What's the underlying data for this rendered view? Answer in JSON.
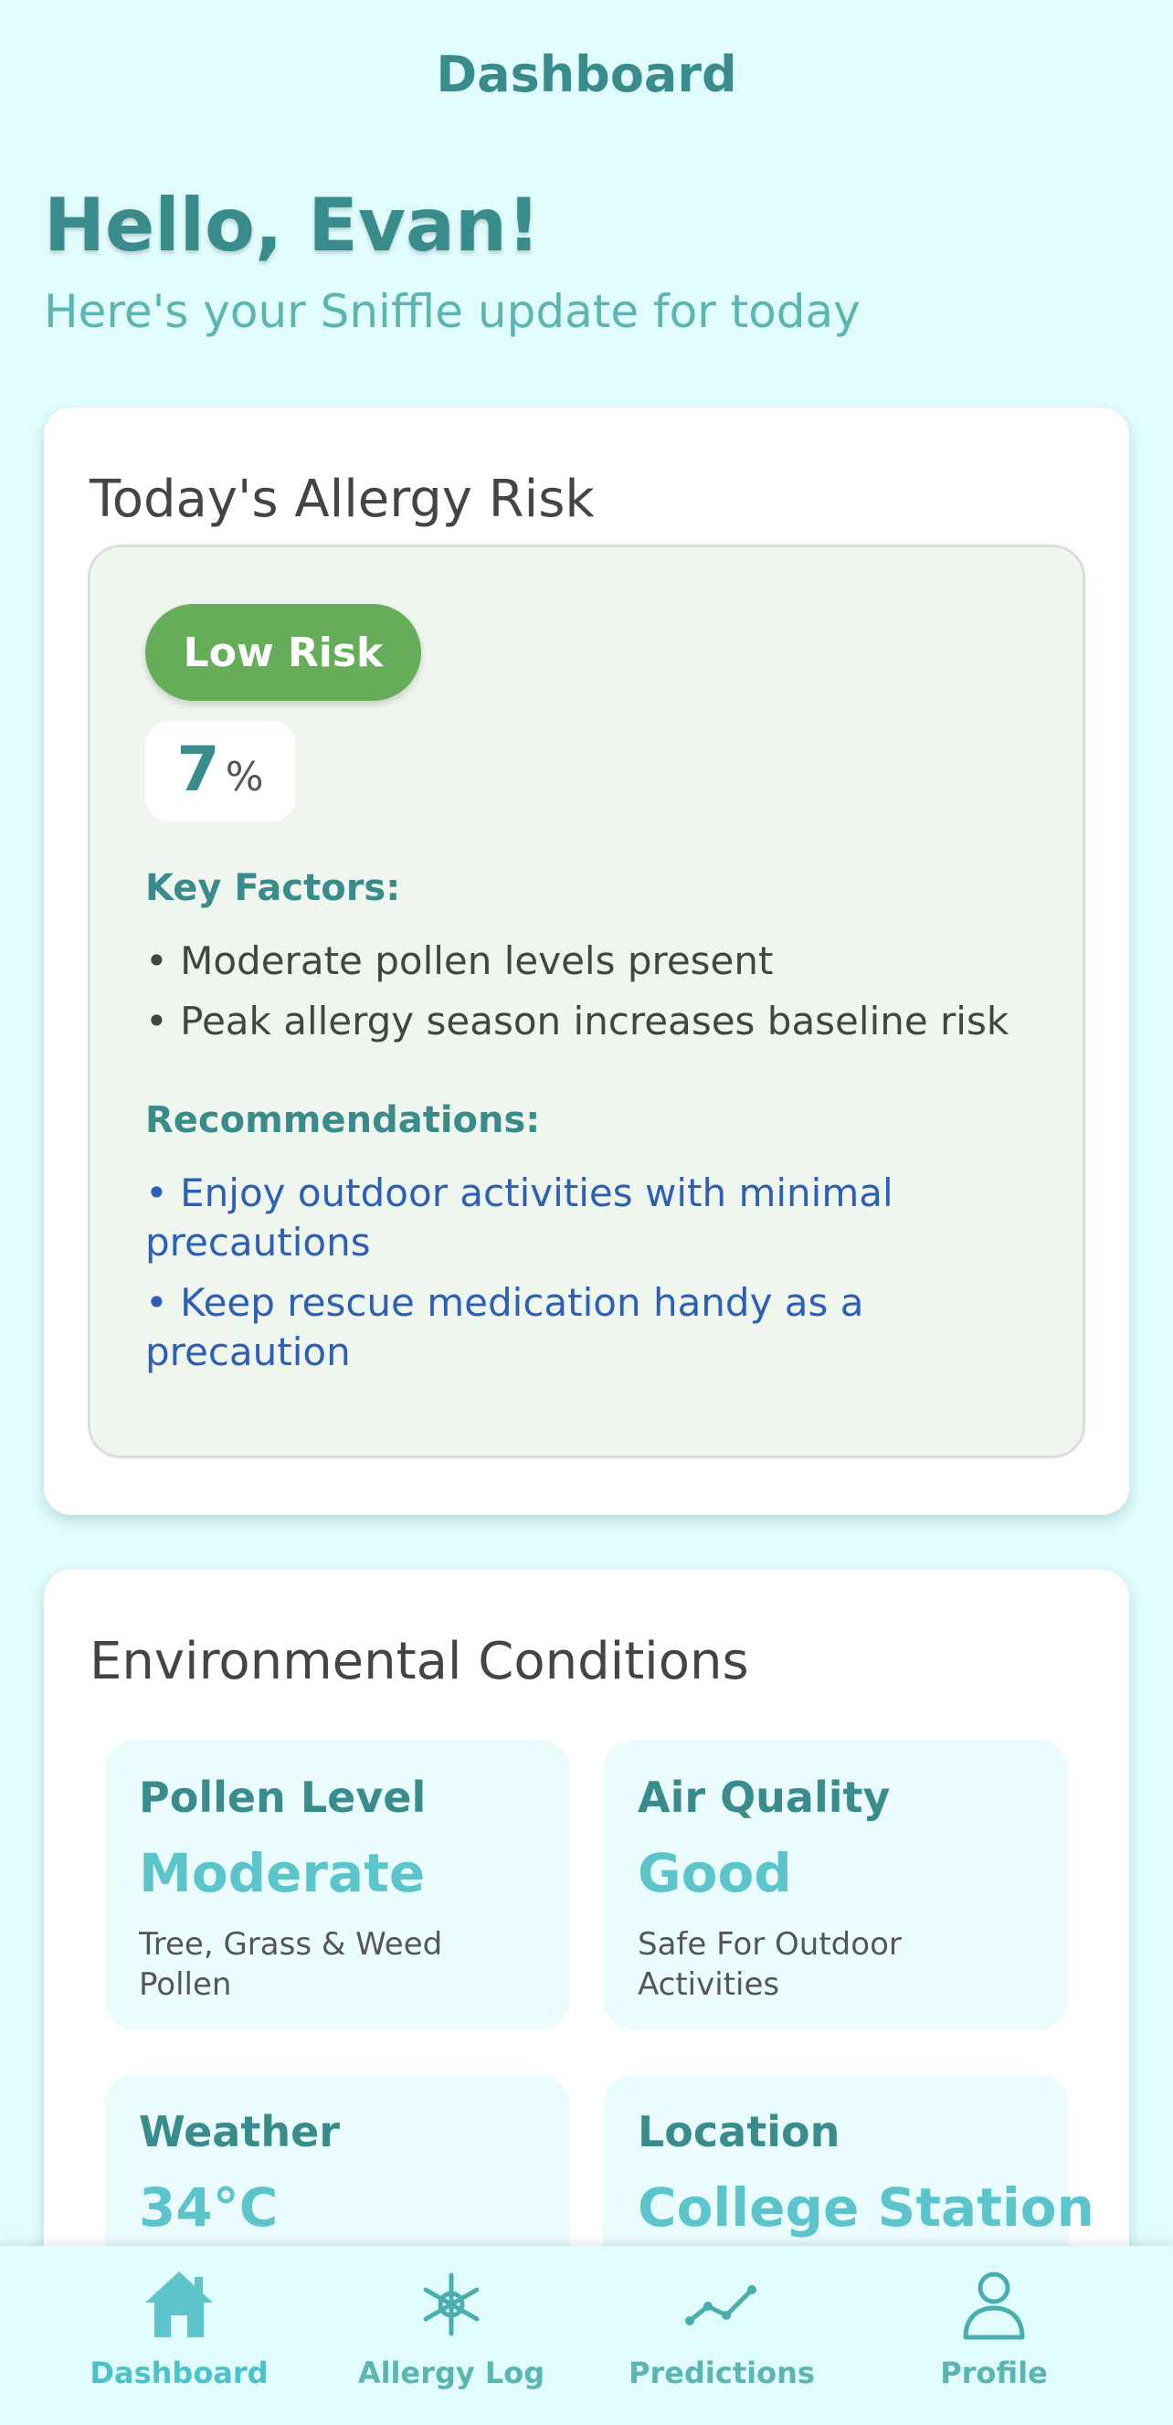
{
  "header": {
    "title": "Dashboard"
  },
  "greeting": {
    "title": "Hello, Evan!",
    "subtitle": "Here's your Sniffle update for today"
  },
  "risk_card": {
    "title": "Today's Allergy Risk",
    "badge": "Low Risk",
    "percent_value": "7",
    "percent_unit": "%",
    "factors_label": "Key Factors:",
    "factors": [
      "• Moderate pollen levels present",
      "• Peak allergy season increases baseline risk"
    ],
    "recommendations_label": "Recommendations:",
    "recommendations": [
      "• Enjoy outdoor activities with minimal precautions",
      "• Keep rescue medication handy as a precaution"
    ]
  },
  "env_card": {
    "title": "Environmental Conditions",
    "tiles": [
      {
        "label": "Pollen Level",
        "value": "Moderate",
        "desc": "Tree, Grass & Weed Pollen"
      },
      {
        "label": "Air Quality",
        "value": "Good",
        "desc": "Safe For Outdoor Activities"
      },
      {
        "label": "Weather",
        "value": "34°C",
        "desc": ""
      },
      {
        "label": "Location",
        "value": "College Station",
        "desc": ""
      }
    ]
  },
  "bottom_nav": {
    "items": [
      {
        "label": "Dashboard",
        "icon": "home-icon",
        "active": true
      },
      {
        "label": "Allergy Log",
        "icon": "asterisk-icon",
        "active": false
      },
      {
        "label": "Predictions",
        "icon": "trend-line-icon",
        "active": false
      },
      {
        "label": "Profile",
        "icon": "user-icon",
        "active": false
      }
    ]
  },
  "colors": {
    "background": "#e0fcfd",
    "accent_teal": "#3a8c8c",
    "low_risk_green": "#66ad5a",
    "recommendation_blue": "#2c5fb8",
    "tile_value": "#5cc5cc"
  }
}
